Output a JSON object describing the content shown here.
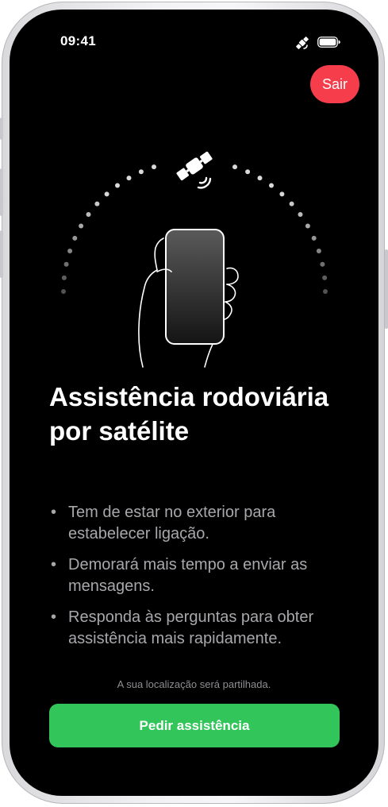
{
  "status_bar": {
    "time": "09:41",
    "satellite_icon": "satellite-icon",
    "battery_icon": "battery-icon"
  },
  "header": {
    "exit_label": "Sair"
  },
  "hero": {
    "satellite_icon": "satellite-icon",
    "phone_icon": "hand-holding-phone-icon",
    "arc_icon": "signal-arc-dots"
  },
  "content": {
    "title": "Assistência rodoviária por satélite",
    "bullets": [
      "Tem de estar no exterior para estabelecer ligação.",
      "Demorará mais tempo a enviar as mensagens.",
      "Responda às perguntas para obter assistência mais rapidamente."
    ],
    "bullet_symbol": "•"
  },
  "footer": {
    "location_note": "A sua localização será partilhada.",
    "primary_button_label": "Pedir assistência"
  },
  "colors": {
    "background": "#000000",
    "exit_button": "#f63d4b",
    "primary_button": "#31c55a",
    "secondary_text": "#a8a8ac"
  }
}
